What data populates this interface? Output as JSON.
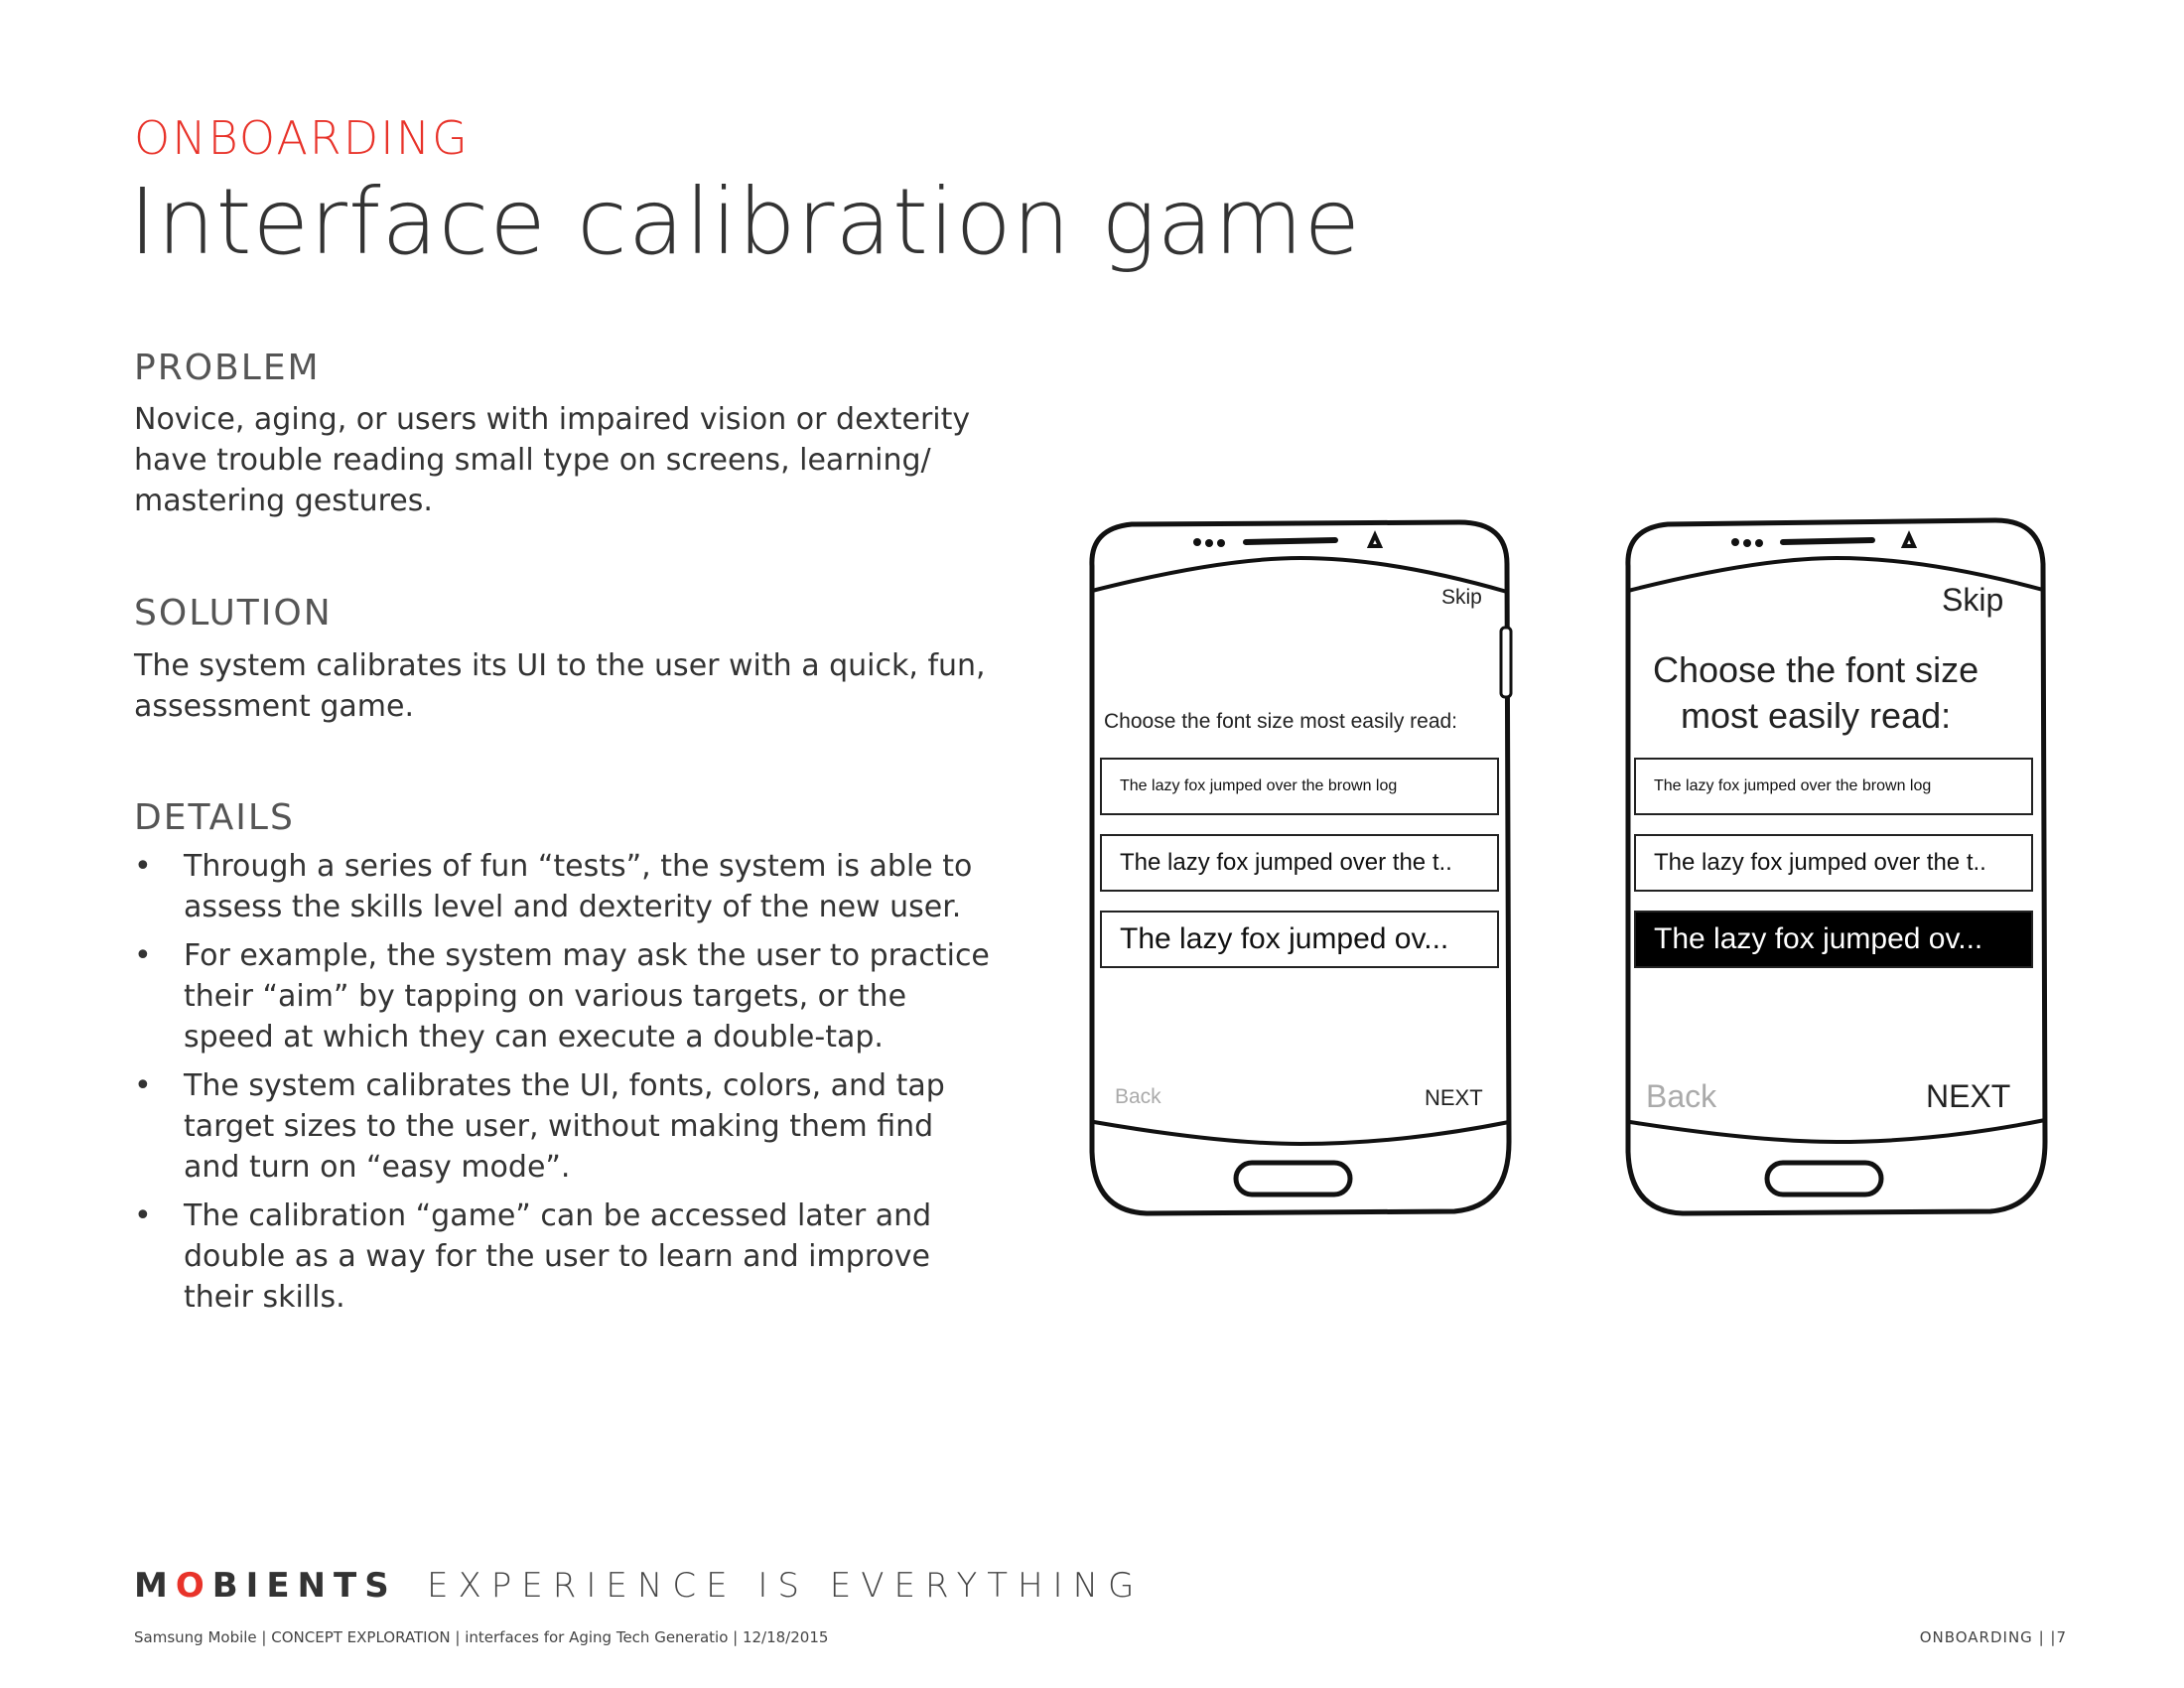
{
  "header": {
    "kicker": "ONBOARDING",
    "title": "Interface calibration game"
  },
  "problem": {
    "heading": "PROBLEM",
    "lines": [
      "Novice, aging, or users with impaired vision or dexterity",
      "have trouble reading small type on screens, learning/",
      "mastering gestures."
    ]
  },
  "solution": {
    "heading": "SOLUTION",
    "lines": [
      "The system calibrates its UI to the user with a quick, fun,",
      "assessment game."
    ]
  },
  "details": {
    "heading": "DETAILS",
    "bullet_symbol": "•",
    "items": [
      [
        "Through a series of fun “tests”, the system is able to",
        "assess the skills level and dexterity of the new user."
      ],
      [
        "For example, the system may ask the user to practice",
        "their “aim” by tapping on various targets, or the",
        "speed at which they can execute a double-tap."
      ],
      [
        "The system calibrates the UI, fonts, colors, and tap",
        "target sizes to the user, without making them find",
        "and turn on “easy mode”."
      ],
      [
        "The calibration “game” can be accessed later and",
        "double as a way for the user to learn and improve",
        "their skills."
      ]
    ]
  },
  "phones": [
    {
      "skip": "Skip",
      "prompt": "Choose the font size most easily read:",
      "options": [
        "The lazy fox jumped over the brown log",
        "The lazy fox jumped over the t..",
        "The lazy fox jumped ov..."
      ],
      "back": "Back",
      "next": "NEXT"
    },
    {
      "skip": "Skip",
      "prompt_line1": "Choose the font size",
      "prompt_line2": "most easily read:",
      "options": [
        "The lazy fox jumped over the brown log",
        "The lazy fox jumped over the t..",
        "The lazy fox jumped ov..."
      ],
      "selected_option": 3,
      "back": "Back",
      "next": "NEXT"
    }
  ],
  "footer": {
    "logo_pre": "M",
    "logo_o": "O",
    "logo_post": "BIENTS",
    "tagline": "EXPERIENCE IS EVERYTHING",
    "footnote": "Samsung Mobile | CONCEPT EXPLORATION | interfaces for Aging Tech Generatio | 12/18/2015",
    "page_label": "ONBOARDING  |  |7"
  },
  "colors": {
    "accent": "#e8332a",
    "text": "#333333",
    "selected_bg": "#000000"
  }
}
